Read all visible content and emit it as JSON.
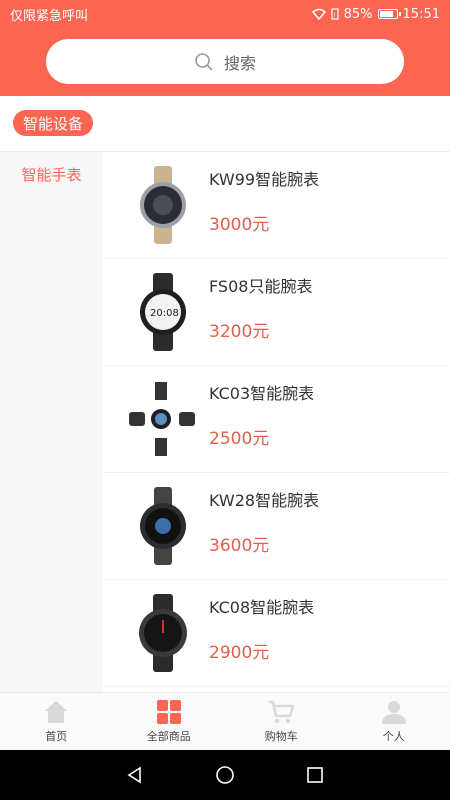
{
  "status_bar": {
    "carrier": "仅限紧急呼叫",
    "battery": "85%",
    "battery_level": 0.85,
    "time": "15:51"
  },
  "search": {
    "placeholder": "搜索"
  },
  "category": {
    "selected": "智能设备"
  },
  "sidebar": {
    "items": [
      {
        "label": "智能手表"
      }
    ]
  },
  "products": [
    {
      "name": "KW99智能腕表",
      "price": "3000元"
    },
    {
      "name": "FS08只能腕表",
      "price": "3200元"
    },
    {
      "name": "KC03智能腕表",
      "price": "2500元"
    },
    {
      "name": "KW28智能腕表",
      "price": "3600元"
    },
    {
      "name": "KC08智能腕表",
      "price": "2900元"
    }
  ],
  "tabs": [
    {
      "label": "首页",
      "icon": "home-icon"
    },
    {
      "label": "全部商品",
      "icon": "grid-icon"
    },
    {
      "label": "购物车",
      "icon": "cart-icon"
    },
    {
      "label": "个人",
      "icon": "person-icon"
    }
  ],
  "colors": {
    "accent": "#fb6552",
    "price": "#e0604d",
    "tab_icon": "#d9d9d9"
  }
}
